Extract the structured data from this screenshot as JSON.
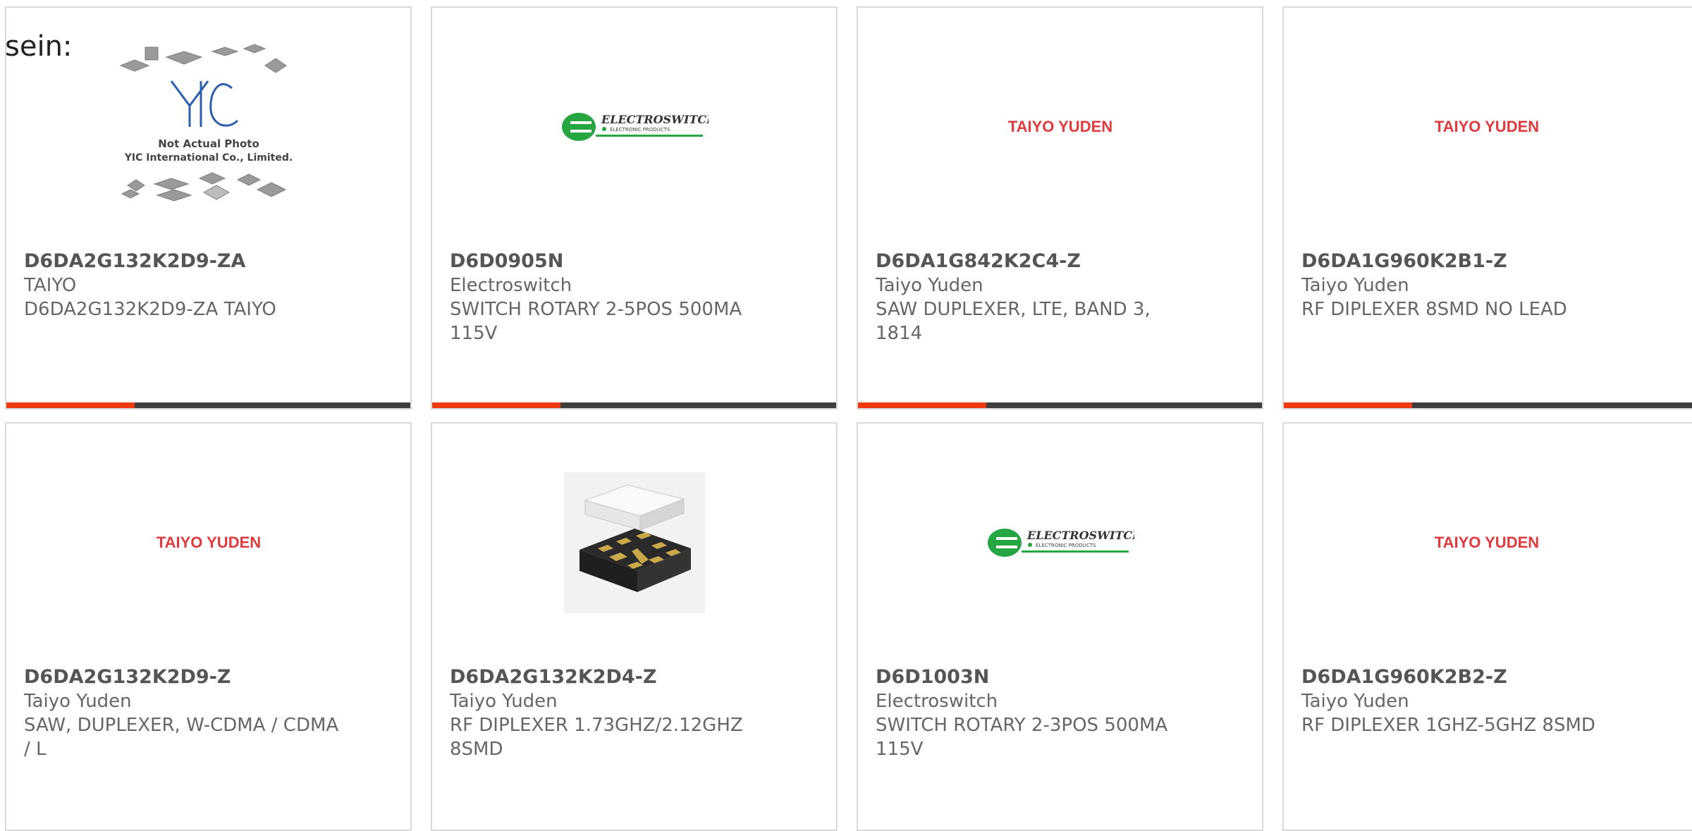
{
  "heading": "sein:",
  "colors": {
    "accent": "#ef3a10",
    "bar": "#3e3e3e",
    "taiyo_red": "#e03a3e",
    "electroswitch_green": "#25a640"
  },
  "products": [
    {
      "part": "D6DA2G132K2D9-ZA",
      "manufacturer": "TAIYO",
      "description": "D6DA2G132K2D9-ZA TAIYO",
      "image": "yic-placeholder",
      "placeholder": {
        "line1": "Not Actual Photo",
        "line2": "YIC International Co., Limited.",
        "logo": "YIC"
      }
    },
    {
      "part": "D6D0905N",
      "manufacturer": "Electroswitch",
      "description": "SWITCH ROTARY 2-5POS 500MA 115V",
      "image": "electroswitch-logo",
      "logo": {
        "name": "ELECTROSWITCH",
        "tagline": "ELECTRONIC PRODUCTS"
      }
    },
    {
      "part": "D6DA1G842K2C4-Z",
      "manufacturer": "Taiyo Yuden",
      "description": "SAW DUPLEXER, LTE, BAND 3, 1814",
      "image": "taiyo-yuden-logo",
      "logo": {
        "name": "TAIYO YUDEN"
      }
    },
    {
      "part": "D6DA1G960K2B1-Z",
      "manufacturer": "Taiyo Yuden",
      "description": "RF DIPLEXER 8SMD NO LEAD",
      "image": "taiyo-yuden-logo",
      "logo": {
        "name": "TAIYO YUDEN"
      }
    },
    {
      "part": "D6DA2G132K2D9-Z",
      "manufacturer": "Taiyo Yuden",
      "description": "SAW, DUPLEXER, W-CDMA / CDMA / L",
      "image": "taiyo-yuden-logo",
      "logo": {
        "name": "TAIYO YUDEN"
      }
    },
    {
      "part": "D6DA2G132K2D4-Z",
      "manufacturer": "Taiyo Yuden",
      "description": "RF DIPLEXER 1.73GHZ/2.12GHZ 8SMD",
      "image": "smd-package-photo"
    },
    {
      "part": "D6D1003N",
      "manufacturer": "Electroswitch",
      "description": "SWITCH ROTARY 2-3POS 500MA 115V",
      "image": "electroswitch-logo",
      "logo": {
        "name": "ELECTROSWITCH",
        "tagline": "ELECTRONIC PRODUCTS"
      }
    },
    {
      "part": "D6DA1G960K2B2-Z",
      "manufacturer": "Taiyo Yuden",
      "description": "RF DIPLEXER 1GHZ-5GHZ 8SMD",
      "image": "taiyo-yuden-logo",
      "logo": {
        "name": "TAIYO YUDEN"
      }
    }
  ]
}
